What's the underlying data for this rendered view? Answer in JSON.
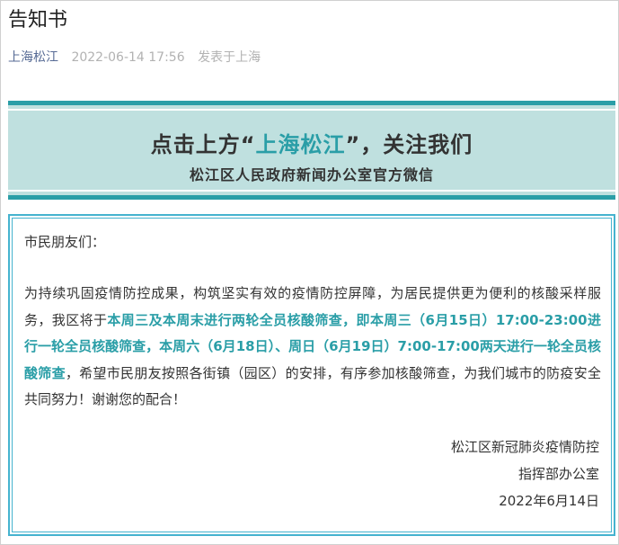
{
  "article": {
    "title": "告知书",
    "account": "上海松江",
    "date": "2022-06-14 17:56",
    "location": "发表于上海"
  },
  "banner": {
    "headline_prefix": "点击上方",
    "headline_quote_open": "“",
    "headline_highlight": "上海松江",
    "headline_quote_close": "”",
    "headline_suffix": "，关注我们",
    "subtitle": "松江区人民政府新闻办公室官方微信"
  },
  "notice": {
    "greeting": "市民朋友们：",
    "para_part1": "为持续巩固疫情防控成果，构筑坚实有效的疫情防控屏障，为居民提供更为便利的核酸采样服务，我区将于",
    "para_emphasis": "本周三及本周末进行两轮全员核酸筛查，即本周三（6月15日）17:00-23:00进行一轮全员核酸筛查，本周六（6月18日）、周日（6月19日）7:00-17:00两天进行一轮全员核酸筛查",
    "para_part2": "，希望市民朋友按照各街镇（园区）的安排，有序参加核酸筛查，为我们城市的防疫安全共同努力！谢谢您的配合！",
    "signature_line1": "松江区新冠肺炎疫情防控",
    "signature_line2": "指挥部办公室",
    "signature_date": "2022年6月14日"
  },
  "colors": {
    "accent": "#2a9ea7",
    "banner_bg": "#bfe0df",
    "notice_border": "#45b3cf",
    "account_link": "#576b95",
    "meta_gray": "#b2b2b2"
  }
}
